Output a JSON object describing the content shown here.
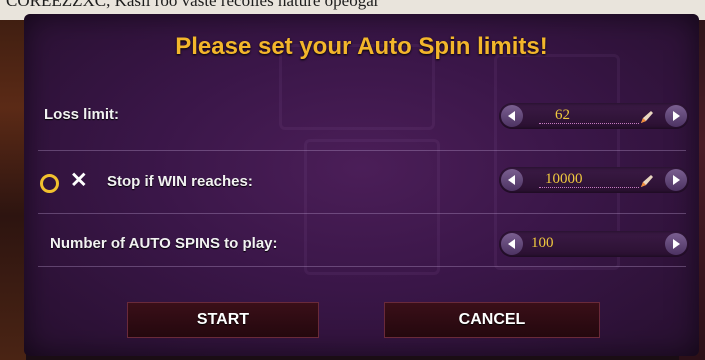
{
  "backdrop_text": "COREEZZXC, Kasii roo vaste recolies nature opeogar",
  "dialog": {
    "title": "Please set your Auto Spin limits!",
    "rows": [
      {
        "label": "Loss limit:",
        "value": "62",
        "editable": true
      },
      {
        "label": "Stop if WIN reaches:",
        "value": "10000",
        "editable": true
      },
      {
        "label": "Number of AUTO SPINS to play:",
        "value": "100",
        "editable": false
      }
    ],
    "stop_toggle": {
      "on_symbol": "O",
      "off_symbol": "✕"
    }
  },
  "buttons": {
    "start": "START",
    "cancel": "CANCEL"
  },
  "colors": {
    "title": "#f3b62b",
    "value": "#f0c93e",
    "panel": "#3a1648",
    "button_bg": "#2e0c14",
    "button_border": "#6a2a3a"
  }
}
